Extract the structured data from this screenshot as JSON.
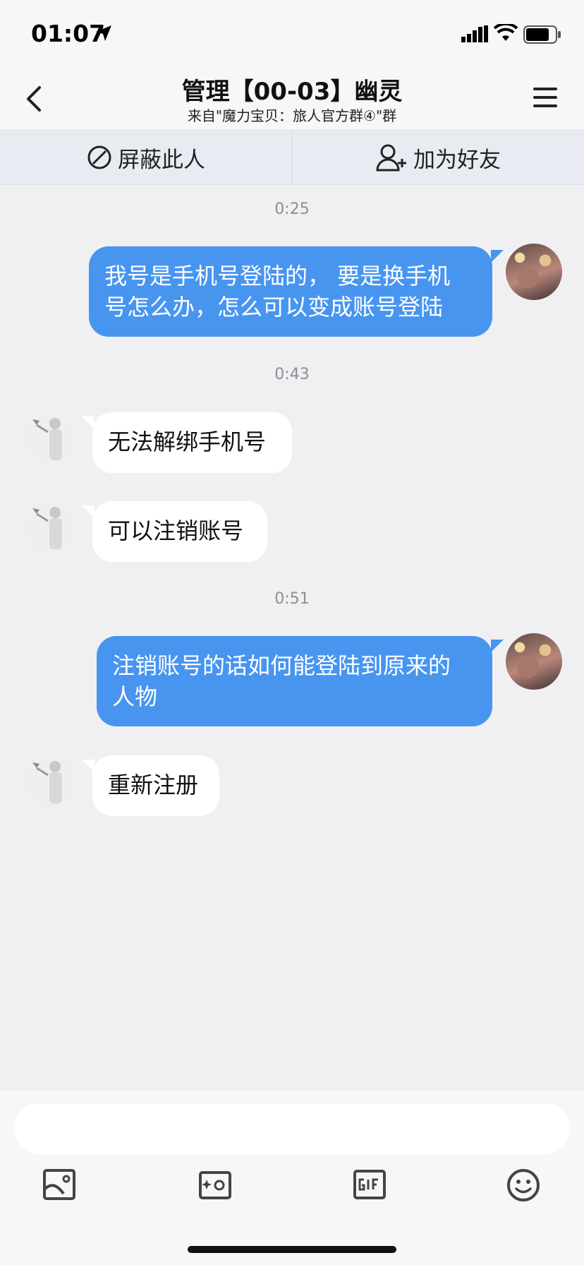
{
  "status_bar": {
    "time": "01:07"
  },
  "header": {
    "title": "管理【00-03】幽灵",
    "subtitle": "来自\"魔力宝贝：旅人官方群④\"群"
  },
  "actions": {
    "block_label": "屏蔽此人",
    "add_friend_label": "加为好友"
  },
  "messages": {
    "ts1": "0:25",
    "m1_line1": "我号是手机号登陆的， 要是换手机",
    "m1_line2": "号怎么办，怎么可以变成账号登陆",
    "ts2": "0:43",
    "m2": "无法解绑手机号",
    "m3": "可以注销账号",
    "ts3": "0:51",
    "m4_line1": "注销账号的话如何能登陆到原来的",
    "m4_line2": "人物",
    "m5": "重新注册"
  },
  "input": {
    "value": "",
    "placeholder": ""
  },
  "toolbar": {
    "icons": [
      "image-icon",
      "camera-icon",
      "gif-icon",
      "emoji-icon"
    ]
  },
  "colors": {
    "outgoing_bubble": "#4895f0",
    "incoming_bubble": "#ffffff",
    "background": "#f0f0f2"
  }
}
